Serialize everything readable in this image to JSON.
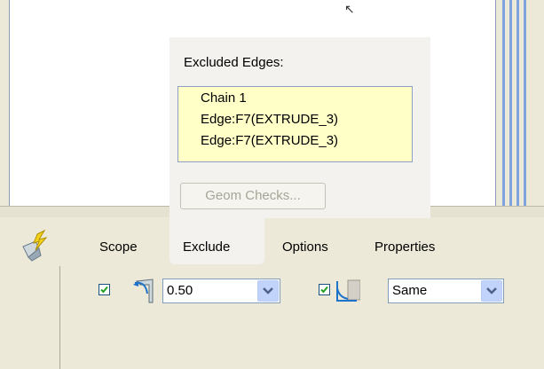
{
  "viewport": {
    "cursor_glyph": "↖"
  },
  "exclude_panel": {
    "title": "Excluded Edges:",
    "items": [
      "Chain 1",
      "Edge:F7(EXTRUDE_3)",
      "Edge:F7(EXTRUDE_3)"
    ],
    "geom_checks_label": "Geom Checks...",
    "list_bg": "#ffffc7"
  },
  "dashboard": {
    "tabs": [
      {
        "label": "Scope"
      },
      {
        "label": "Exclude"
      },
      {
        "label": "Options"
      },
      {
        "label": "Properties"
      }
    ],
    "active_tab": "Exclude",
    "radius_checkbox_checked": true,
    "radius_value": "0.50",
    "transition_checkbox_checked": true,
    "transition_value": "Same",
    "icons": [
      "round-tool-icon",
      "radius-icon",
      "transition-icon"
    ]
  },
  "colors": {
    "accent": "#7fa3dc",
    "checkmark": "#21a121",
    "dropdown_button": "#c1d3fb"
  }
}
